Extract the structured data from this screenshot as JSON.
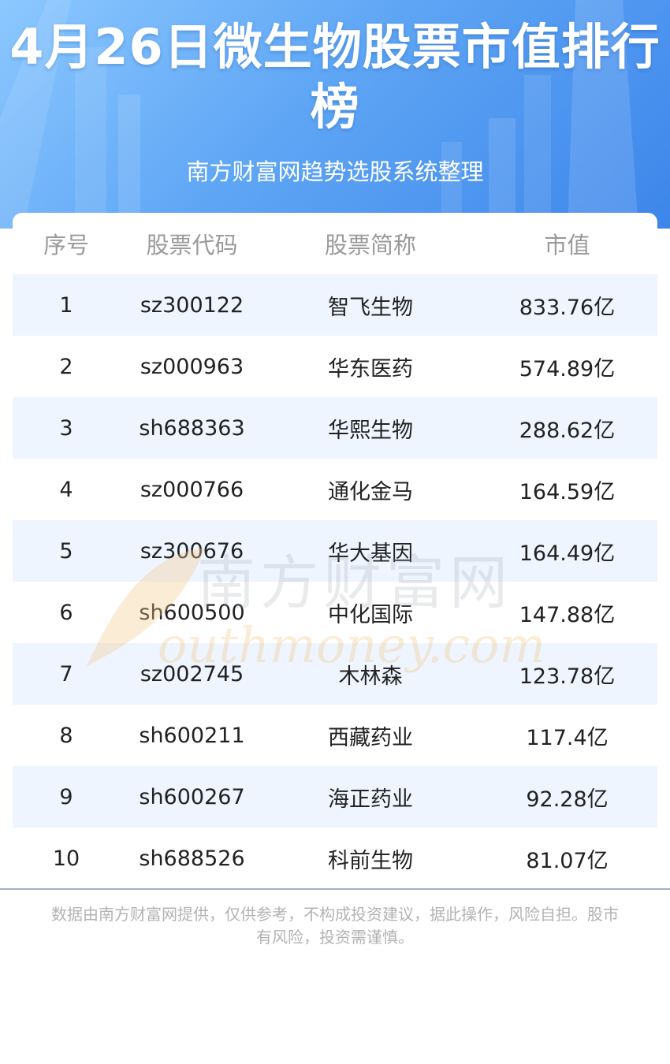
{
  "header": {
    "title": "4月26日微生物股票市值排行榜",
    "subtitle": "南方财富网趋势选股系统整理"
  },
  "table": {
    "columns": [
      "序号",
      "股票代码",
      "股票简称",
      "市值"
    ],
    "rows": [
      {
        "rank": "1",
        "code": "sz300122",
        "name": "智飞生物",
        "value": "833.76亿"
      },
      {
        "rank": "2",
        "code": "sz000963",
        "name": "华东医药",
        "value": "574.89亿"
      },
      {
        "rank": "3",
        "code": "sh688363",
        "name": "华熙生物",
        "value": "288.62亿"
      },
      {
        "rank": "4",
        "code": "sz000766",
        "name": "通化金马",
        "value": "164.59亿"
      },
      {
        "rank": "5",
        "code": "sz300676",
        "name": "华大基因",
        "value": "164.49亿"
      },
      {
        "rank": "6",
        "code": "sh600500",
        "name": "中化国际",
        "value": "147.88亿"
      },
      {
        "rank": "7",
        "code": "sz002745",
        "name": "木林森",
        "value": "123.78亿"
      },
      {
        "rank": "8",
        "code": "sh600211",
        "name": "西藏药业",
        "value": "117.4亿"
      },
      {
        "rank": "9",
        "code": "sh600267",
        "name": "海正药业",
        "value": "92.28亿"
      },
      {
        "rank": "10",
        "code": "sh688526",
        "name": "科前生物",
        "value": "81.07亿"
      }
    ]
  },
  "watermark": {
    "cn": "南方财富网",
    "en": "outhmoney.com"
  },
  "footer": {
    "disclaimer": "数据由南方财富网提供，仅供参考，不构成投资建议，据此操作，风险自担。股市有风险，投资需谨慎。"
  },
  "colors": {
    "header_light": "#8cc8ff",
    "header_dark": "#3d86ea",
    "row_alt": "#eef5ff",
    "watermark": "#f3c98a"
  }
}
